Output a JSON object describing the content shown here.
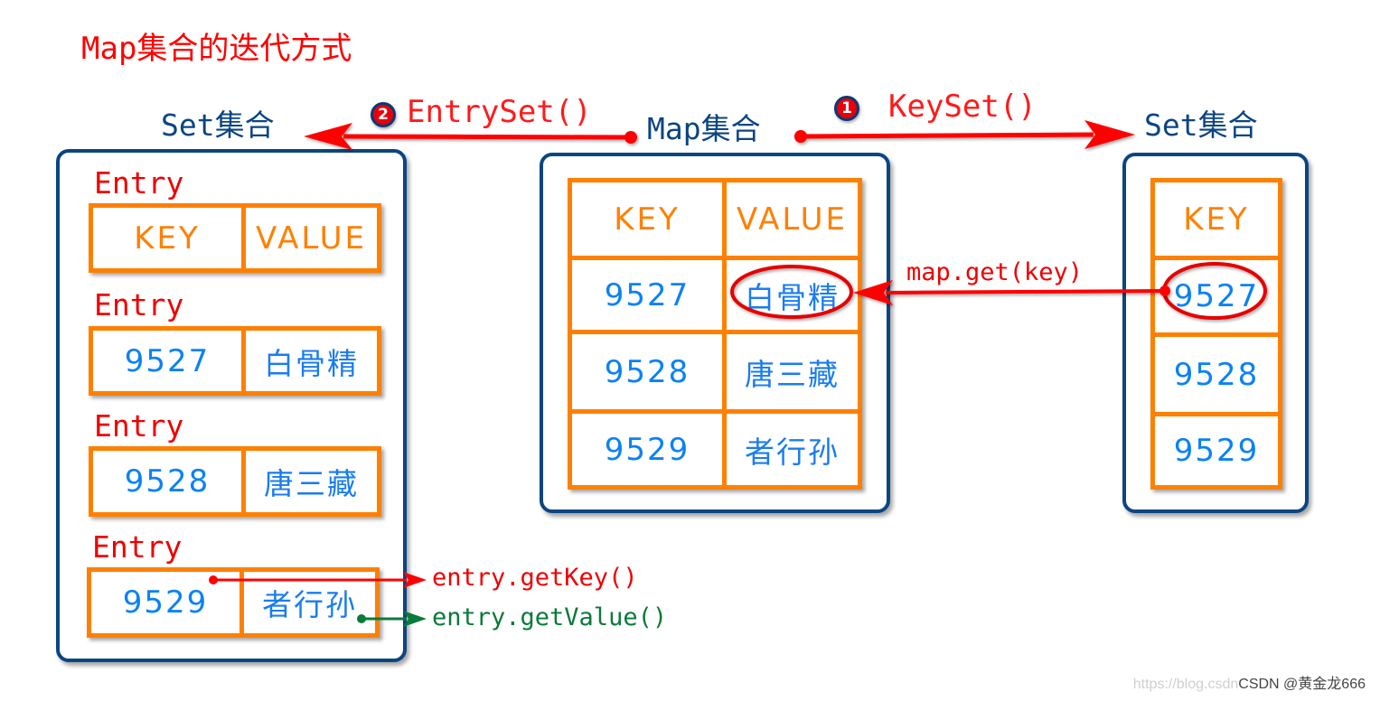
{
  "title": "Map集合的迭代方式",
  "colors": {
    "title": "#ff0000",
    "collection_label": "#0b4582",
    "panel_border": "#0b4582",
    "cell_border": "#ff8000",
    "header_text": "#ff8000",
    "key_text": "#0a82f5",
    "arrow_red": "#ff0000",
    "arrow_green": "#0a7a3a",
    "badge_fill": "#e8000b"
  },
  "map": {
    "label": "Map集合",
    "headers": {
      "key": "KEY",
      "value": "VALUE"
    },
    "rows": [
      {
        "key": "9527",
        "value": "白骨精"
      },
      {
        "key": "9528",
        "value": "唐三藏"
      },
      {
        "key": "9529",
        "value": "者行孙"
      }
    ]
  },
  "entry_set": {
    "label": "Set集合",
    "method": "EntrySet()",
    "step": "2",
    "entry_label": "Entry",
    "entries": [
      {
        "key": "KEY",
        "value": "VALUE"
      },
      {
        "key": "9527",
        "value": "白骨精"
      },
      {
        "key": "9528",
        "value": "唐三藏"
      },
      {
        "key": "9529",
        "value": "者行孙"
      }
    ],
    "get_key": "entry.getKey()",
    "get_value": "entry.getValue()"
  },
  "key_set": {
    "label": "Set集合",
    "method": "KeySet()",
    "step": "1",
    "header": "KEY",
    "keys": [
      "9527",
      "9528",
      "9529"
    ],
    "lookup": "map.get(key)"
  },
  "watermark": {
    "faint": "https://blog.csdn",
    "text": "CSDN @黄金龙666"
  }
}
